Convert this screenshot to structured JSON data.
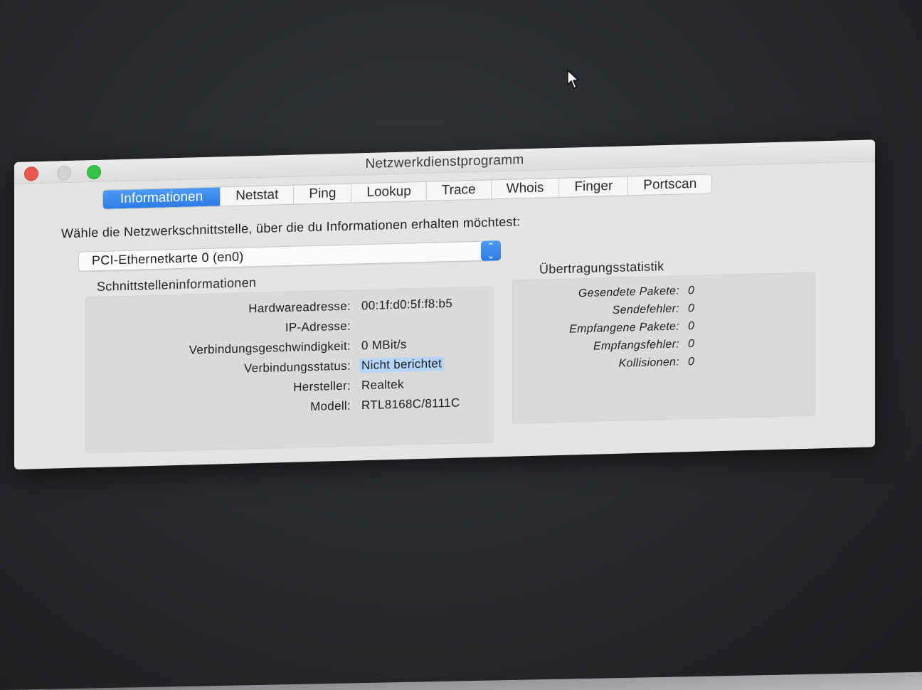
{
  "window": {
    "title": "Netzwerkdienstprogramm"
  },
  "tabs": [
    {
      "label": "Informationen",
      "active": true
    },
    {
      "label": "Netstat",
      "active": false
    },
    {
      "label": "Ping",
      "active": false
    },
    {
      "label": "Lookup",
      "active": false
    },
    {
      "label": "Trace",
      "active": false
    },
    {
      "label": "Whois",
      "active": false
    },
    {
      "label": "Finger",
      "active": false
    },
    {
      "label": "Portscan",
      "active": false
    }
  ],
  "prompt": "Wähle die Netzwerkschnittstelle, über die du Informationen erhalten möchtest:",
  "interface_select": {
    "value": "PCI-Ethernetkarte 0 (en0)"
  },
  "interface_info": {
    "title": "Schnittstelleninformationen",
    "rows": [
      {
        "label": "Hardwareadresse:",
        "value": "00:1f:d0:5f:f8:b5"
      },
      {
        "label": "IP-Adresse:",
        "value": ""
      },
      {
        "label": "Verbindungsgeschwindigkeit:",
        "value": "0 MBit/s"
      },
      {
        "label": "Verbindungsstatus:",
        "value": "Nicht berichtet"
      },
      {
        "label": "Hersteller:",
        "value": "Realtek"
      },
      {
        "label": "Modell:",
        "value": "RTL8168C/8111C"
      }
    ]
  },
  "transfer_stats": {
    "title": "Übertragungsstatistik",
    "rows": [
      {
        "label": "Gesendete Pakete:",
        "value": "0"
      },
      {
        "label": "Sendefehler:",
        "value": "0"
      },
      {
        "label": "Empfangene Pakete:",
        "value": "0"
      },
      {
        "label": "Empfangsfehler:",
        "value": "0"
      },
      {
        "label": "Kollisionen:",
        "value": "0"
      }
    ]
  },
  "colors": {
    "accent": "#2c7ce8",
    "close": "#e9574d",
    "zoom": "#37c348",
    "selection": "#b6d5fb"
  }
}
